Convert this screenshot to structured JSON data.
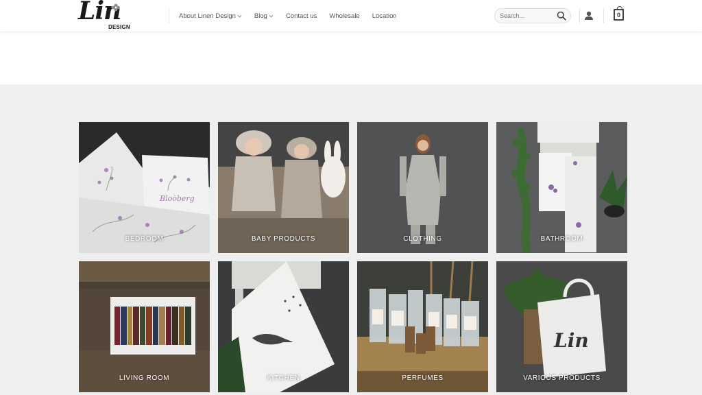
{
  "header": {
    "logo": {
      "name": "Lin",
      "sub": "DESIGN"
    },
    "nav": [
      {
        "label": "About Linen Design",
        "has_dropdown": true
      },
      {
        "label": "Blog",
        "has_dropdown": true
      },
      {
        "label": "Contact us",
        "has_dropdown": false
      },
      {
        "label": "Wholesale",
        "has_dropdown": false
      },
      {
        "label": "Location",
        "has_dropdown": false
      }
    ],
    "search": {
      "placeholder": "Search..."
    },
    "cart": {
      "count": "0"
    }
  },
  "categories": [
    {
      "label": "BEDROOM"
    },
    {
      "label": "BABY PRODUCTS"
    },
    {
      "label": "CLOTHING"
    },
    {
      "label": "BATHROOM"
    },
    {
      "label": "LIVING ROOM"
    },
    {
      "label": "KITCHEN"
    },
    {
      "label": "PERFUMES"
    },
    {
      "label": "VARIOUS PRODUCTS"
    }
  ],
  "colors": {
    "background_section": "#efefef",
    "text_nav": "#555555",
    "tile_label": "#ffffff"
  }
}
